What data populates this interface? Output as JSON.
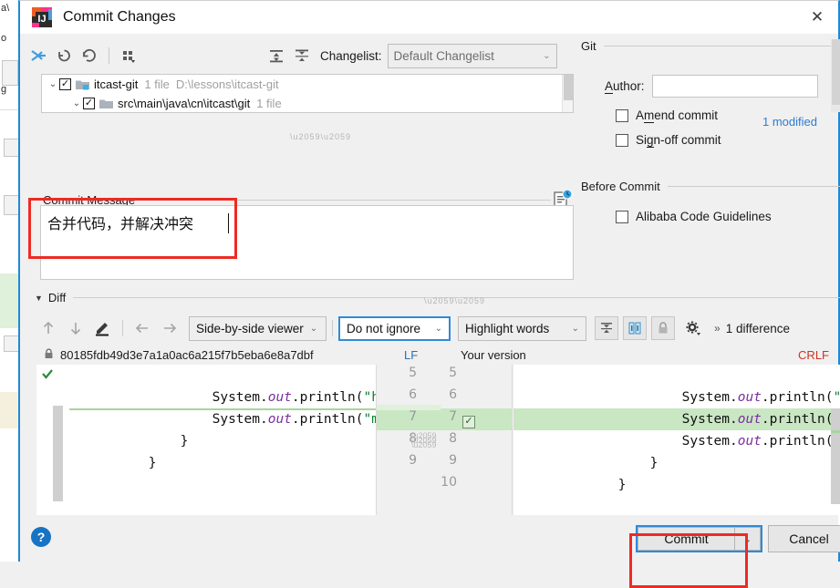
{
  "window": {
    "title": "Commit Changes",
    "app_icon": "intellij-idea-icon",
    "close_label": "✕"
  },
  "toolbar": {
    "icons": [
      {
        "name": "show-diff-icon",
        "glyph": "↲"
      },
      {
        "name": "revert-icon",
        "glyph": "↺"
      },
      {
        "name": "refresh-icon",
        "glyph": "↻"
      },
      {
        "name": "group-by-icon",
        "glyph": "⡇"
      },
      {
        "name": "expand-all-icon",
        "glyph": "≡"
      },
      {
        "name": "collapse-all-icon",
        "glyph": "≡"
      }
    ],
    "changelist_label": "Changelist:",
    "changelist_value": "Default Changelist",
    "changelist_arrow": "⌄"
  },
  "tree": {
    "rows": [
      {
        "expander": "⌄",
        "checked": true,
        "check_glyph": "✓",
        "icon": "module-folder-icon",
        "name": "itcast-git",
        "file_count": "1 file",
        "path": "D:\\lessons\\itcast-git",
        "indent": 0
      },
      {
        "expander": "⌄",
        "checked": true,
        "check_glyph": "✓",
        "icon": "folder-icon",
        "name": "src\\main\\java\\cn\\itcast\\git",
        "file_count": "1 file",
        "path": "",
        "indent": 1
      }
    ],
    "status": "1 modified",
    "status_color": "#2b7cd3"
  },
  "commit_message": {
    "label": "Commit Message",
    "value": "合并代码，并解决冲突",
    "history_icon": "commit-history-icon"
  },
  "right_panel": {
    "git_section": "Git",
    "author_label": "Author:",
    "author_value": "",
    "amend_label": "Amend commit",
    "amend_checked": false,
    "signoff_label": "Sign-off commit",
    "signoff_checked": false,
    "before_commit_section": "Before Commit",
    "alibaba_label": "Alibaba Code Guidelines",
    "alibaba_checked": false
  },
  "diff": {
    "section_label": "Diff",
    "section_caret": "▼",
    "toolbar": {
      "prev_diff_icon": "↑",
      "next_diff_icon": "↓",
      "edit_icon": "✎",
      "apply_left_icon": "←",
      "apply_right_icon": "→",
      "viewer_mode": "Side-by-side viewer",
      "viewer_arrow": "⌄",
      "ignore_mode": "Do not ignore",
      "ignore_arrow": "⌄",
      "highlight_mode": "Highlight words",
      "highlight_arrow": "⌄",
      "collapse_unchanged_icon": "collapse-unchanged-icon",
      "synchronize_icon": "synchronize-scroll-icon",
      "lock_icon": "read-only-lock-icon",
      "settings_icon": "gear-icon",
      "more_icon": "»",
      "difference_count": "1 difference"
    },
    "file_header": {
      "lock_icon": "lock-icon",
      "revision_hash": "80185fdb49d3e7a1a0ac6a215f7b5eba6e8a7dbf",
      "left_eol": "LF",
      "right_title": "Your version",
      "right_eol": "CRLF"
    },
    "left_lines": [
      {
        "num": "5",
        "text": "        System.out.println(\"hel",
        "segments": [
          {
            "t": "        System.",
            "c": "kw-sys"
          },
          {
            "t": "out",
            "c": "kw-out"
          },
          {
            "t": ".println(",
            "c": "kw-sys"
          },
          {
            "t": "\"hel",
            "c": "kw-str"
          }
        ],
        "state": "context"
      },
      {
        "num": "6",
        "text": "        System.out.println(\"mas",
        "segments": [
          {
            "t": "        System.",
            "c": "kw-sys"
          },
          {
            "t": "out",
            "c": "kw-out"
          },
          {
            "t": ".println(",
            "c": "kw-sys"
          },
          {
            "t": "\"mas",
            "c": "kw-str"
          }
        ],
        "state": "context"
      },
      {
        "num": "7",
        "text": "    }",
        "segments": [
          {
            "t": "    }",
            "c": "kw-sys"
          }
        ],
        "state": "context"
      },
      {
        "num": "8",
        "text": "}",
        "segments": [
          {
            "t": "}",
            "c": "kw-sys"
          }
        ],
        "state": "context"
      },
      {
        "num": "9",
        "text": "",
        "segments": [],
        "state": "context"
      }
    ],
    "right_lines": [
      {
        "num": "5",
        "text": "        System.out.println(\"he!l",
        "segments": [
          {
            "t": "        System.",
            "c": "kw-sys"
          },
          {
            "t": "out",
            "c": "kw-out"
          },
          {
            "t": ".println(",
            "c": "kw-sys"
          },
          {
            "t": "\"he",
            "c": "kw-str"
          }
        ],
        "state": "context"
      },
      {
        "num": "6",
        "text": "        System.out.println(\"mast",
        "segments": [
          {
            "t": "        System.",
            "c": "kw-sys"
          },
          {
            "t": "out",
            "c": "kw-out"
          },
          {
            "t": ".println(",
            "c": "kw-sys"
          },
          {
            "t": "\"mast",
            "c": "kw-str"
          }
        ],
        "state": "context"
      },
      {
        "num": "7",
        "text": "        System.out.println(\"dev",
        "segments": [
          {
            "t": "        System.",
            "c": "kw-sys"
          },
          {
            "t": "out",
            "c": "kw-out"
          },
          {
            "t": ".println(",
            "c": "kw-sys"
          },
          {
            "t": "\"dev",
            "c": "kw-str"
          }
        ],
        "state": "added"
      },
      {
        "num": "8",
        "text": "    }",
        "segments": [
          {
            "t": "    }",
            "c": "kw-sys"
          }
        ],
        "state": "context"
      },
      {
        "num": "9",
        "text": "}",
        "segments": [
          {
            "t": "}",
            "c": "kw-sys"
          }
        ],
        "state": "context"
      },
      {
        "num": "10",
        "text": "",
        "segments": [],
        "state": "context"
      }
    ],
    "accept_change_glyph": "✓",
    "added_color": "#c9e7c3"
  },
  "footer": {
    "help_label": "?",
    "commit_label": "Commit",
    "commit_arrow": "⌄",
    "cancel_label": "Cancel"
  },
  "annotations": {
    "highlight_color": "#ee2a24"
  }
}
